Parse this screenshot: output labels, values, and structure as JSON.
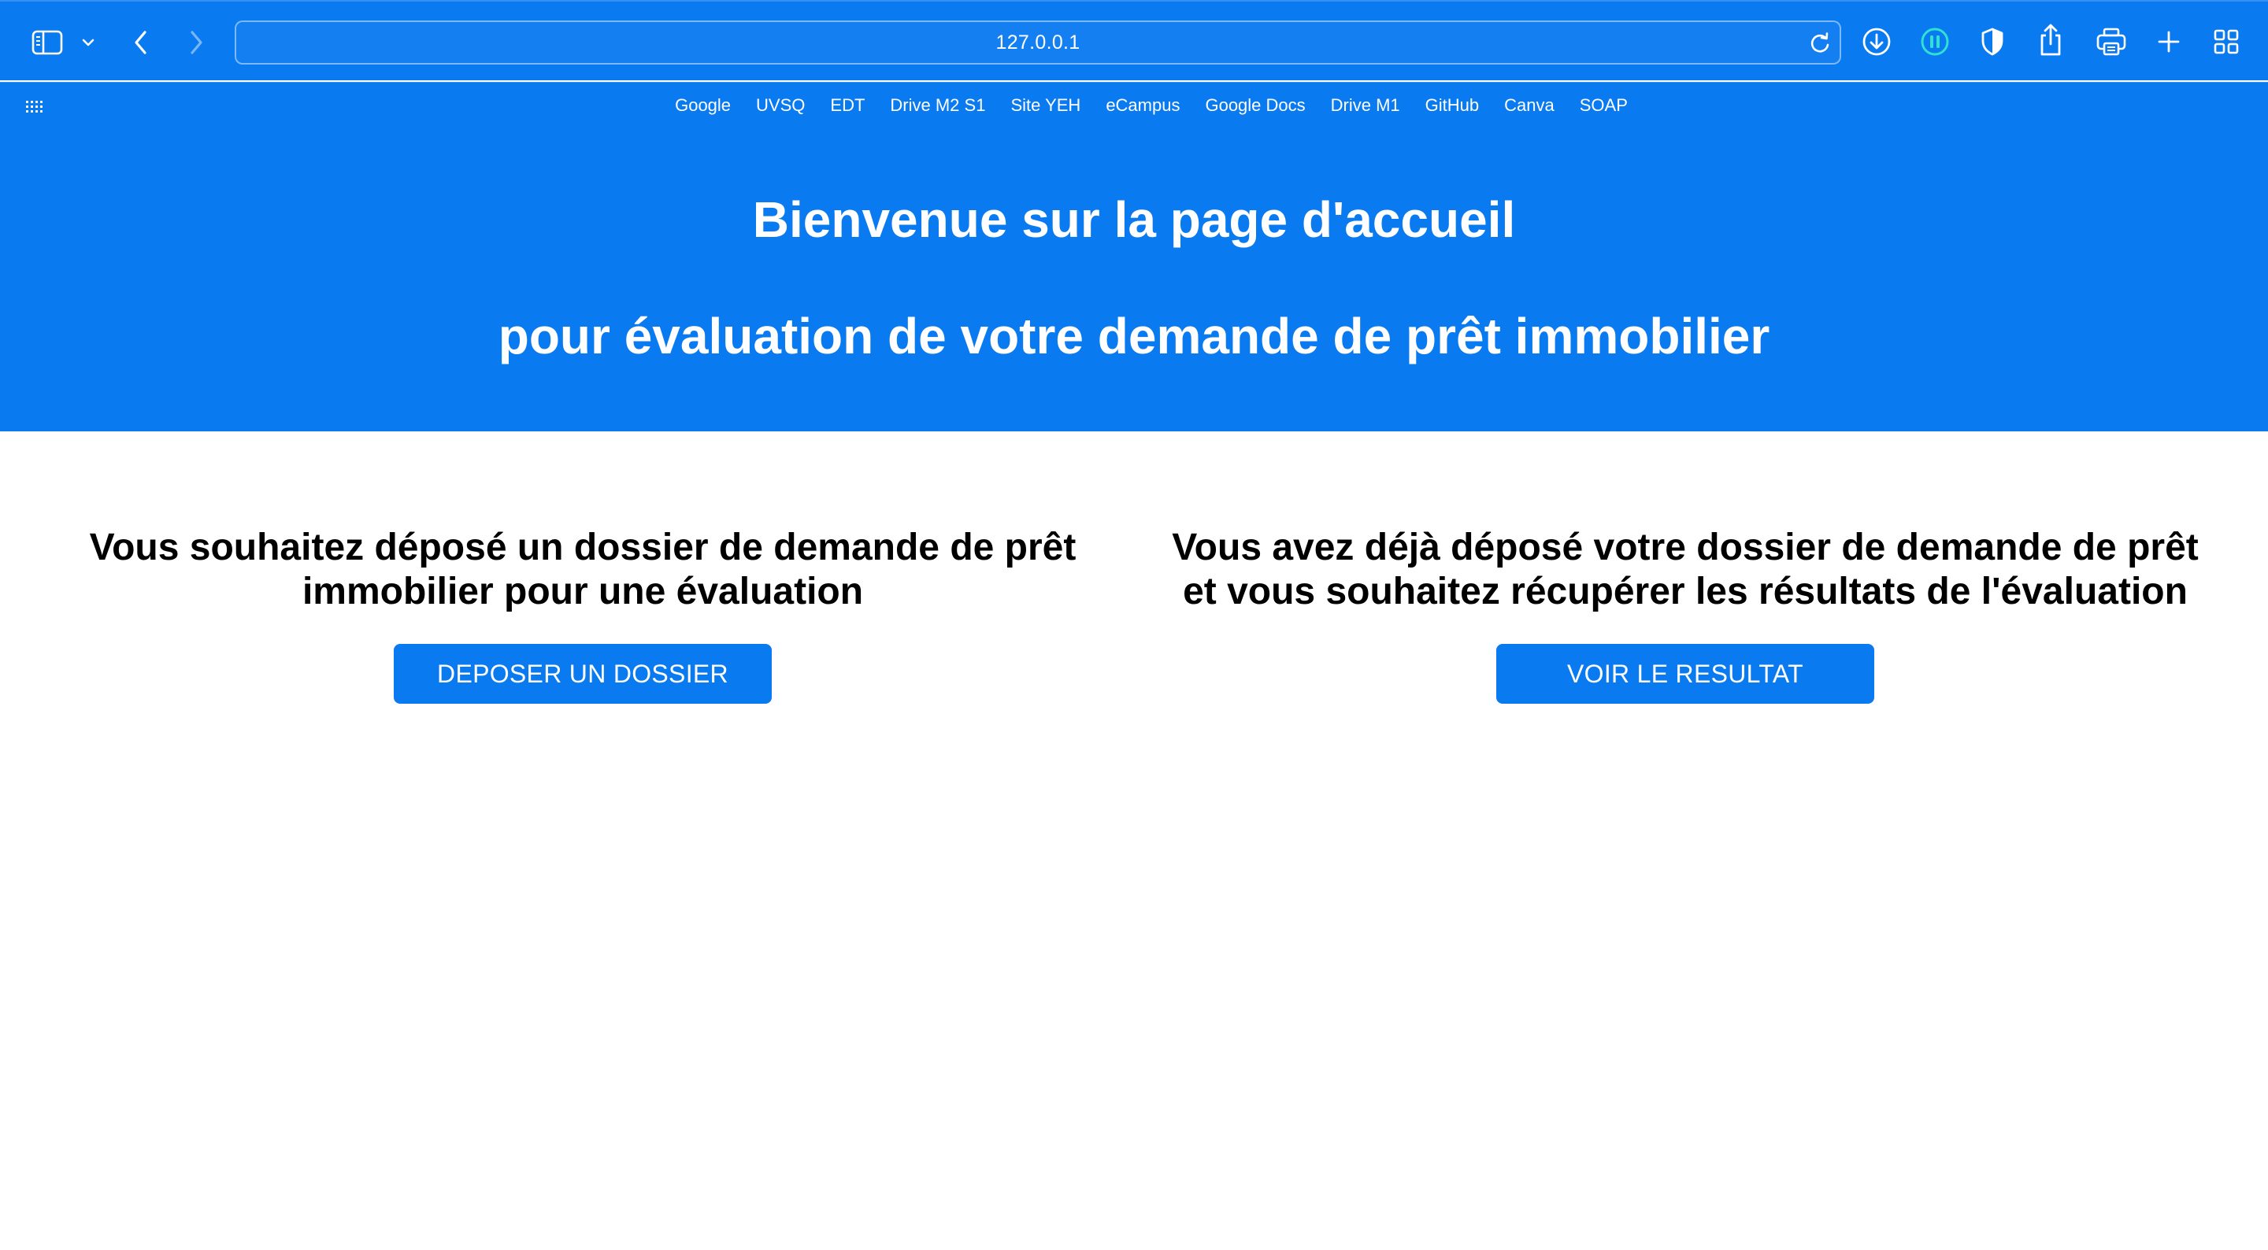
{
  "browser": {
    "url": "127.0.0.1",
    "accent_color": "#0a7af0",
    "toolbar_icons": [
      "sidebar-icon",
      "chevron-down-icon",
      "back-icon",
      "forward-icon",
      "reload-icon",
      "download-icon",
      "pause-icon",
      "shield-icon",
      "share-icon",
      "printer-icon",
      "new-tab-icon",
      "tab-overview-icon"
    ],
    "bookmarks": [
      "Google",
      "UVSQ",
      "EDT",
      "Drive M2 S1",
      "Site YEH",
      "eCampus",
      "Google Docs",
      "Drive M1",
      "GitHub",
      "Canva",
      "SOAP"
    ]
  },
  "page": {
    "hero": {
      "title": "Bienvenue sur la page d'accueil",
      "subtitle": "pour évaluation de votre demande de prêt immobilier"
    },
    "left_panel": {
      "heading_line1": "Vous souhaitez déposé un dossier de demande de prêt",
      "heading_line2": "immobilier pour une évaluation",
      "button_label": "DEPOSER UN DOSSIER"
    },
    "right_panel": {
      "heading_line1": "Vous avez déjà déposé votre dossier de demande de prêt",
      "heading_line2": "et vous souhaitez récupérer les résultats de l'évaluation",
      "button_label": "VOIR LE RESULTAT"
    }
  }
}
